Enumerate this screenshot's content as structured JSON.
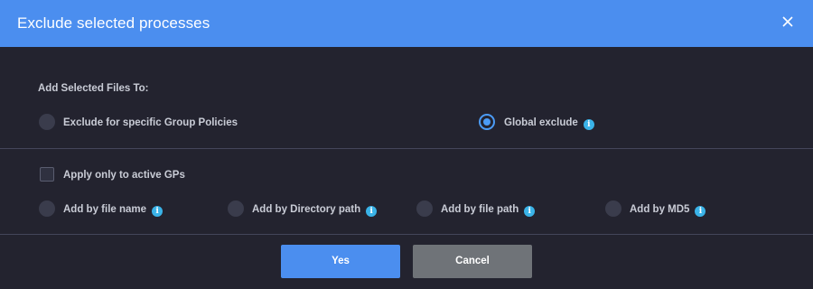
{
  "dialog": {
    "title": "Exclude selected processes",
    "close_icon": "close-icon"
  },
  "section1": {
    "heading": "Add Selected Files To:",
    "options": [
      {
        "label": "Exclude for specific Group Policies",
        "checked": false,
        "info": false
      },
      {
        "label": "Global exclude",
        "checked": true,
        "info": true
      }
    ]
  },
  "section2": {
    "checkbox_label": "Apply only to active GPs",
    "checkbox_checked": false,
    "options": [
      {
        "label": "Add by file name",
        "info": true
      },
      {
        "label": "Add by Directory path",
        "info": true
      },
      {
        "label": "Add by file path",
        "info": true
      },
      {
        "label": "Add by MD5",
        "info": true
      }
    ],
    "info_glyph": "i"
  },
  "buttons": {
    "yes_label": "Yes",
    "cancel_label": "Cancel"
  },
  "colors": {
    "accent": "#4b8eef",
    "background": "#23232f",
    "info": "#3ab3e8",
    "cancel": "#6f7378"
  }
}
